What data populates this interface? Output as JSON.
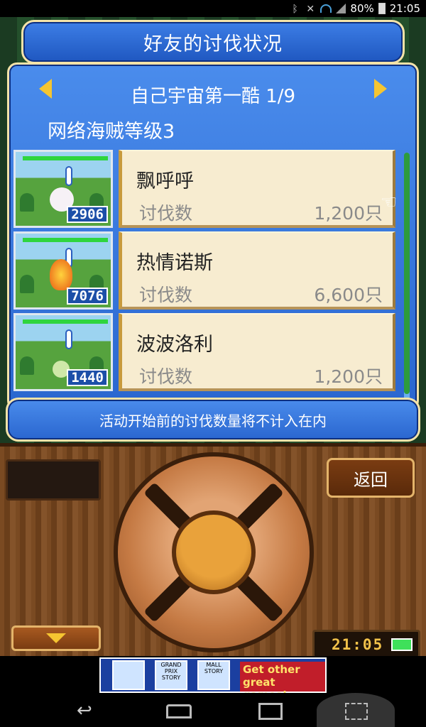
{
  "status_bar": {
    "battery_percent": "80%",
    "time": "21:05"
  },
  "header": {
    "title": "好友的讨伐状况",
    "friend_name": "自己宇宙第一酷 1/9",
    "pirate_level": "网络海贼等级3"
  },
  "monsters": [
    {
      "name": "飘呼呼",
      "kill_label": "讨伐数",
      "kill_count": "1,200只",
      "thumb_number": "2906"
    },
    {
      "name": "热情诺斯",
      "kill_label": "讨伐数",
      "kill_count": "6,600只",
      "thumb_number": "7076"
    },
    {
      "name": "波波洛利",
      "kill_label": "讨伐数",
      "kill_count": "1,200只",
      "thumb_number": "1440"
    }
  ],
  "notice": "活动开始前的讨伐数量将不计入在内",
  "controller": {
    "back_label": "返回",
    "clock": "21:05"
  },
  "ad": {
    "tile_1": "GRAND PRIX STORY",
    "tile_2": "MALL STORY",
    "cta": "Get other great games!"
  },
  "colors": {
    "panel_blue": "#2a66cf",
    "panel_border": "#f4e3a8",
    "card_bg": "#f7ecd0",
    "hp_green": "#2fd53e",
    "arrow_yellow": "#f5c531"
  }
}
